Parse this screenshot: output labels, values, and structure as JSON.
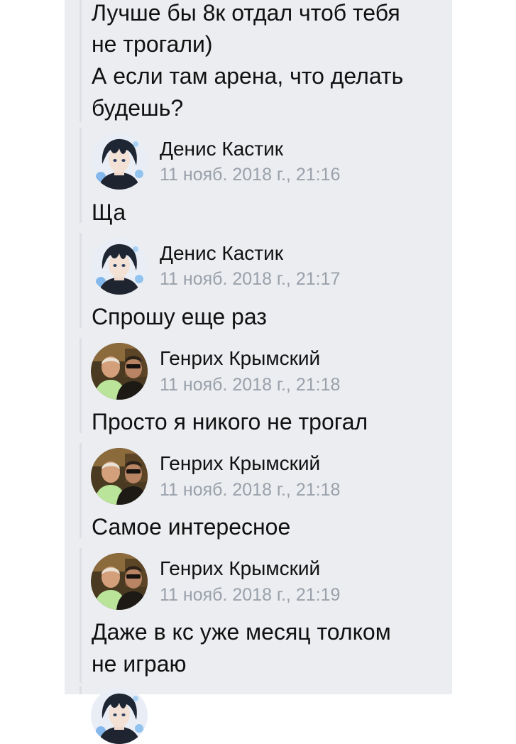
{
  "chat": {
    "prev_message": {
      "lines": [
        "Лучше бы 8к отдал чтоб тебя",
        "не трогали)",
        "А если там арена, что делать",
        "будешь?"
      ]
    },
    "messages": [
      {
        "author": "Денис Кастик",
        "time": "11 нояб. 2018 г., 21:16",
        "avatar": "anime-avatar",
        "lines": [
          "Ща"
        ]
      },
      {
        "author": "Денис Кастик",
        "time": "11 нояб. 2018 г., 21:17",
        "avatar": "anime-avatar",
        "lines": [
          "Спрошу еще раз"
        ]
      },
      {
        "author": "Генрих Крымский",
        "time": "11 нояб. 2018 г., 21:18",
        "avatar": "photo-avatar",
        "lines": [
          "Просто я никого не трогал"
        ]
      },
      {
        "author": "Генрих Крымский",
        "time": "11 нояб. 2018 г., 21:18",
        "avatar": "photo-avatar",
        "lines": [
          "Самое интересное"
        ]
      },
      {
        "author": "Генрих Крымский",
        "time": "11 нояб. 2018 г., 21:19",
        "avatar": "photo-avatar",
        "lines": [
          "Даже в кс уже месяц толком",
          "не играю"
        ]
      }
    ]
  },
  "colors": {
    "panel_background": "#ebedf0",
    "text": "#111111",
    "timestamp": "#9aa1ab",
    "quote_bar": "#dcdfe4"
  }
}
